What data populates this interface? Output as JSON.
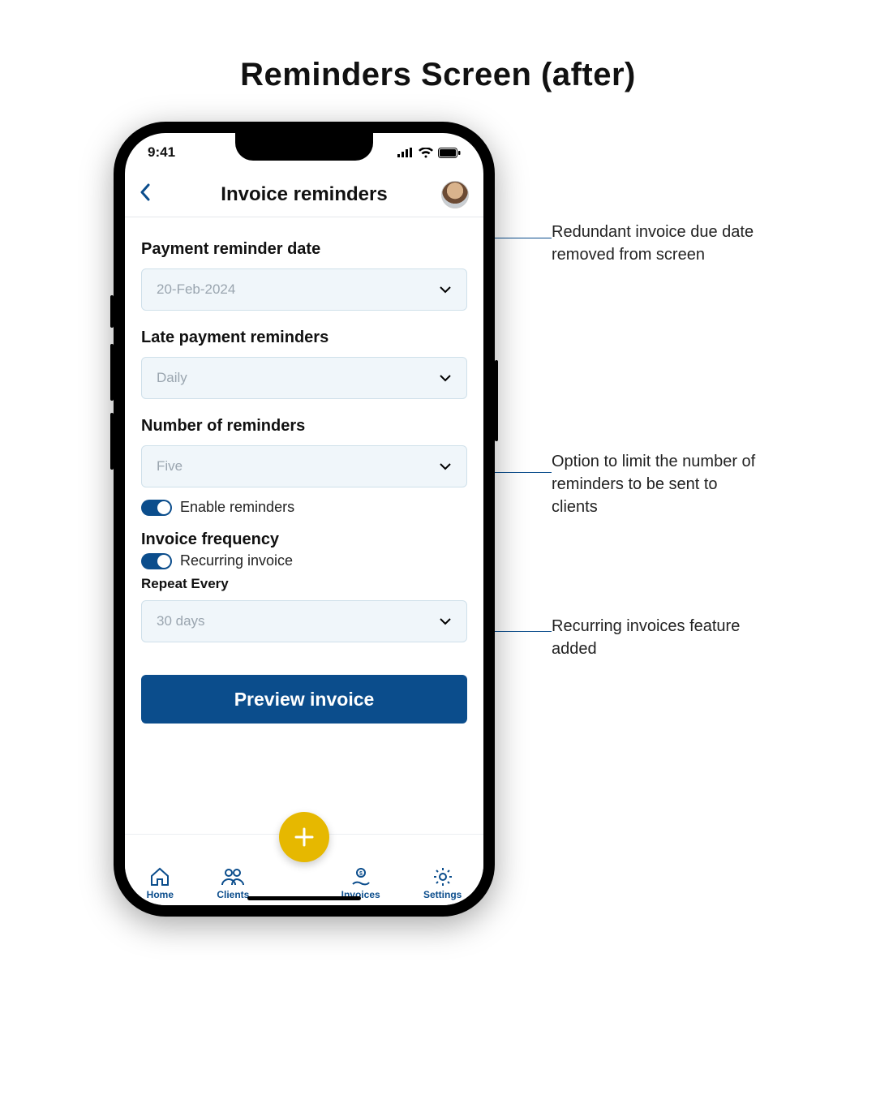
{
  "page": {
    "title": "Reminders Screen (after)"
  },
  "status": {
    "time": "9:41"
  },
  "header": {
    "title": "Invoice reminders"
  },
  "fields": {
    "payment_reminder_date": {
      "label": "Payment reminder date",
      "value": "20-Feb-2024"
    },
    "late_payment_reminders": {
      "label": "Late payment reminders",
      "value": "Daily"
    },
    "number_of_reminders": {
      "label": "Number of reminders",
      "value": "Five"
    },
    "enable_reminders": {
      "label": "Enable reminders",
      "on": true
    },
    "invoice_frequency": {
      "label": "Invoice frequency"
    },
    "recurring_invoice": {
      "label": "Recurring invoice",
      "on": true
    },
    "repeat_every": {
      "label": "Repeat Every",
      "value": "30 days"
    }
  },
  "buttons": {
    "preview": "Preview invoice"
  },
  "nav": {
    "items": [
      {
        "label": "Home"
      },
      {
        "label": "Clients"
      },
      {
        "label": "Invoices"
      },
      {
        "label": "Settings"
      }
    ]
  },
  "annotations": [
    {
      "text": "Redundant invoice due date removed from screen"
    },
    {
      "text": "Option to limit the number of reminders to be sent to clients"
    },
    {
      "text": "Recurring invoices feature added"
    }
  ]
}
